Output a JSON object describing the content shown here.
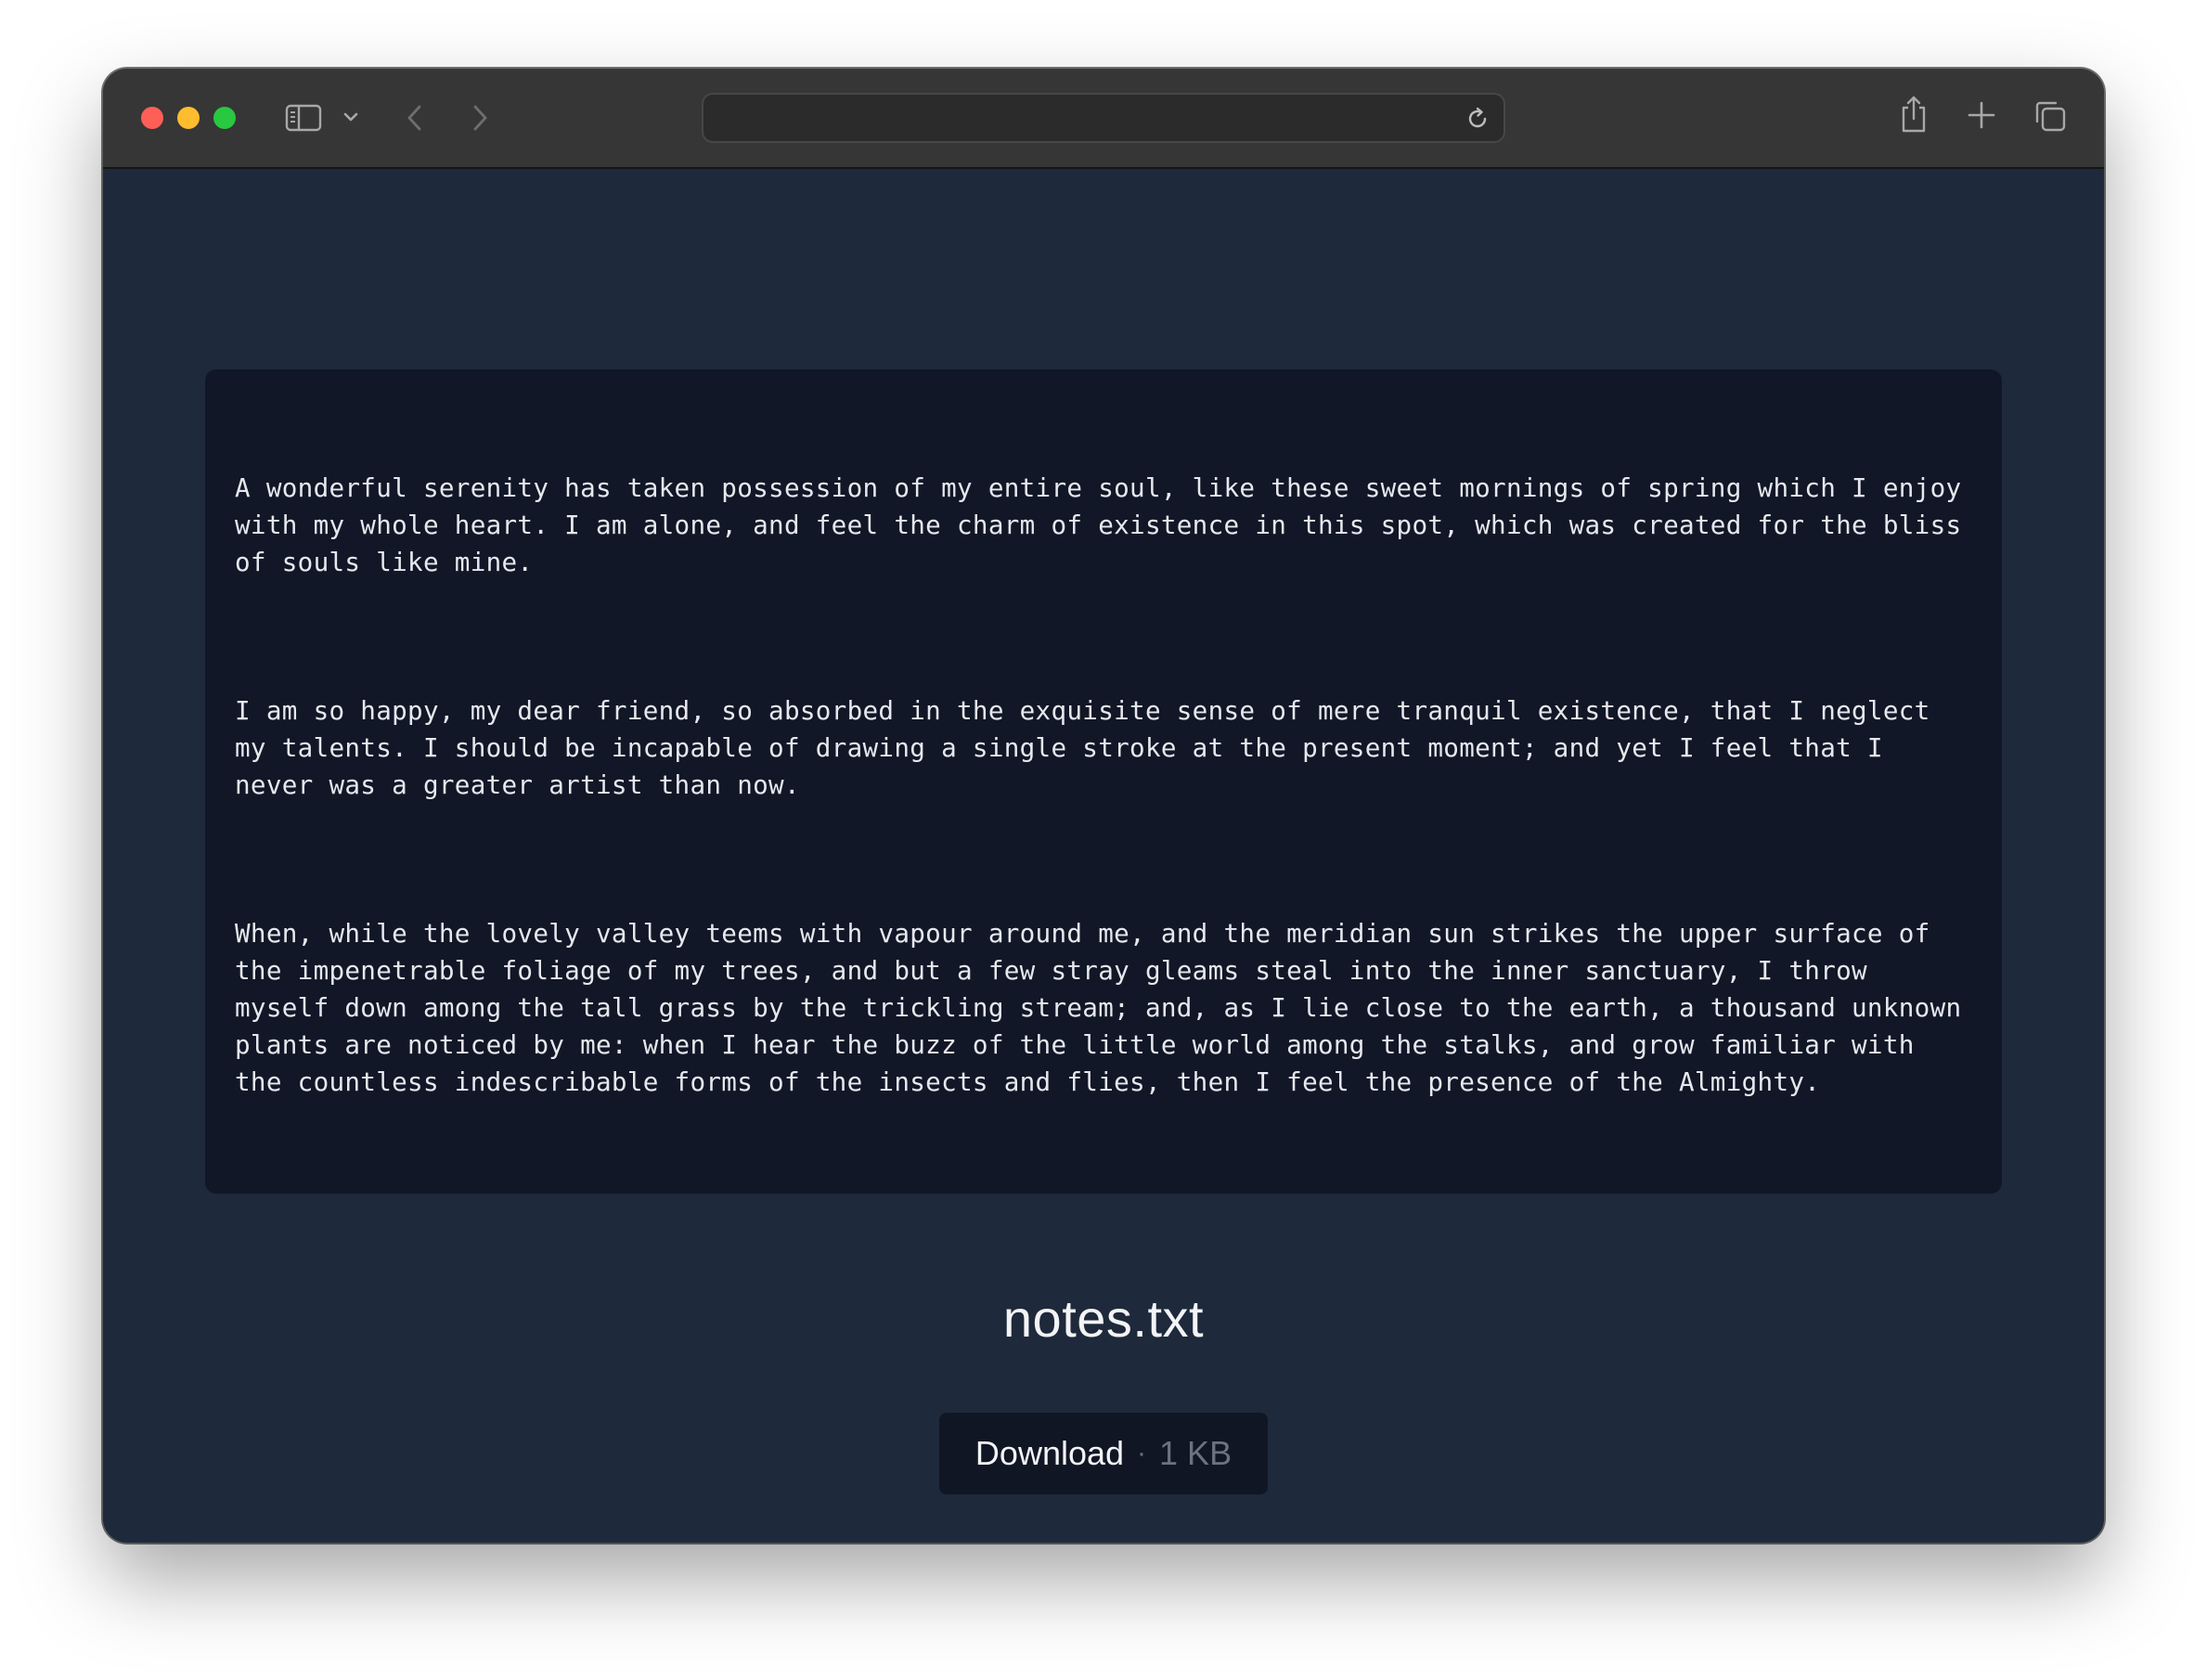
{
  "browser": {
    "address": "",
    "icons": {
      "sidebar": "sidebar-icon",
      "chevron": "chevron-down-icon",
      "back": "back-arrow-icon",
      "forward": "forward-arrow-icon",
      "reload": "reload-icon",
      "share": "share-icon",
      "new_tab": "plus-icon",
      "tabs": "tab-overview-icon"
    }
  },
  "file": {
    "paragraphs": [
      "A wonderful serenity has taken possession of my entire soul, like these sweet mornings of spring which I enjoy with my whole heart. I am alone, and feel the charm of existence in this spot, which was created for the bliss of souls like mine.",
      "I am so happy, my dear friend, so absorbed in the exquisite sense of mere tranquil existence, that I neglect my talents. I should be incapable of drawing a single stroke at the present moment; and yet I feel that I never was a greater artist than now.",
      "When, while the lovely valley teems with vapour around me, and the meridian sun strikes the upper surface of the impenetrable foliage of my trees, and but a few stray gleams steal into the inner sanctuary, I throw myself down among the tall grass by the trickling stream; and, as I lie close to the earth, a thousand unknown plants are noticed by me: when I hear the buzz of the little world among the stalks, and grow familiar with the countless indescribable forms of the insects and flies, then I feel the presence of the Almighty."
    ],
    "name": "notes.txt",
    "download_label": "Download",
    "separator": "·",
    "size": "1 KB"
  },
  "colors": {
    "page_bg": "#1e293b",
    "panel_bg": "#111727",
    "titlebar": "#363636"
  }
}
